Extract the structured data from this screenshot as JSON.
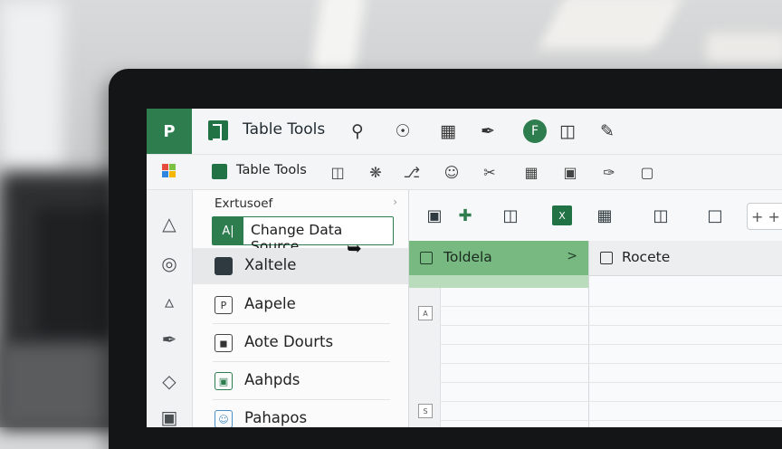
{
  "window": {
    "title": "Table Tools",
    "app_icon_glyph": "P",
    "accent_color": "#2e7d4f",
    "title_icons": [
      "search-icon",
      "person-pin-icon",
      "grid-icon",
      "pen-tool-icon",
      "excel-circle-icon",
      "panel-icon",
      "edit-icon"
    ]
  },
  "ribbon": {
    "label": "Table Tools",
    "icons": [
      "table-icon",
      "share-icon",
      "tag-icon",
      "user-icon",
      "scissors-icon",
      "chart-icon",
      "image-icon",
      "pen-icon",
      "frame-icon"
    ]
  },
  "left_rail": {
    "icons": [
      "shapes-icon",
      "target-icon",
      "filter-icon",
      "draw-icon",
      "tag-outline-icon",
      "stamp-icon"
    ]
  },
  "side_panel": {
    "heading": "Exrtusoef",
    "action": {
      "badge": "A|",
      "label": "Change Data Source"
    },
    "items": [
      {
        "label": "Xaltele",
        "icon": "table-fill-icon",
        "selected": true
      },
      {
        "label": "Aapele",
        "icon": "page-icon",
        "selected": false
      },
      {
        "label": "Aote Dourts",
        "icon": "cup-icon",
        "selected": false
      },
      {
        "label": "Aahpds",
        "icon": "image-green-icon",
        "selected": false
      },
      {
        "label": "Pahapos",
        "icon": "people-icon",
        "selected": false
      }
    ]
  },
  "main_toolbar": {
    "icons": [
      "insert-icon",
      "add-field-icon",
      "columns-icon",
      "excel-icon",
      "flag-table-icon",
      "excel-doc-icon",
      "comment-icon"
    ],
    "plus_label": "+ +"
  },
  "grid": {
    "columns": [
      {
        "label": "Toldela",
        "chevron": ">",
        "active": true
      },
      {
        "label": "Rocete",
        "active": false
      }
    ],
    "row_markers": [
      "A",
      "S"
    ]
  }
}
